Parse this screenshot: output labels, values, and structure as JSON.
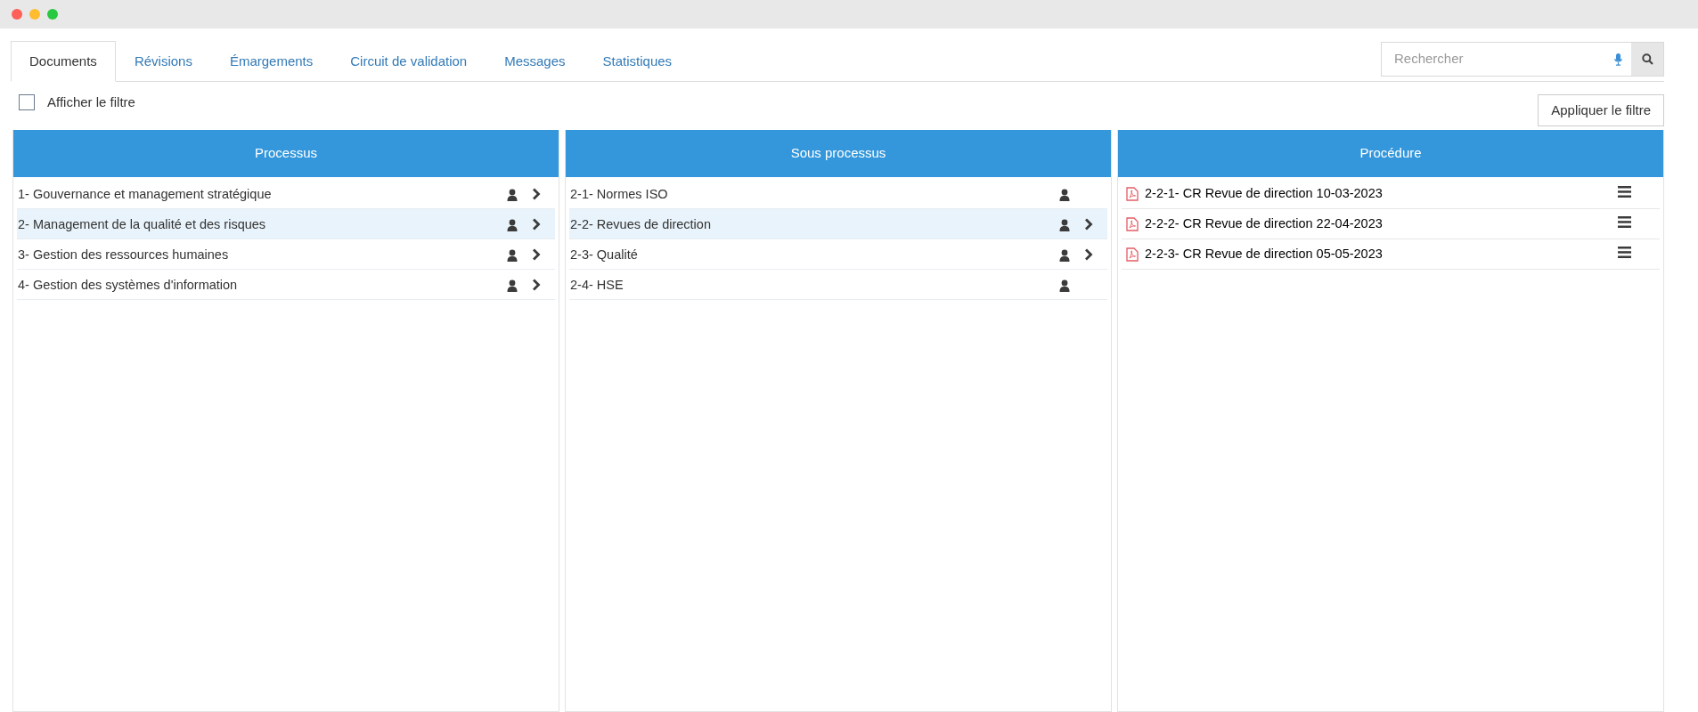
{
  "tabs": [
    {
      "label": "Documents",
      "selected": true
    },
    {
      "label": "Révisions",
      "selected": false
    },
    {
      "label": "Émargements",
      "selected": false
    },
    {
      "label": "Circuit de validation",
      "selected": false
    },
    {
      "label": "Messages",
      "selected": false
    },
    {
      "label": "Statistiques",
      "selected": false
    }
  ],
  "search": {
    "placeholder": "Rechercher"
  },
  "filter": {
    "label": "Afficher le filtre",
    "checked": false,
    "apply_button": "Appliquer le filtre"
  },
  "columns": [
    {
      "title": "Processus",
      "kind": "tree",
      "items": [
        {
          "label": "1- Gouvernance et management stratégique",
          "selected": false,
          "has_children": true
        },
        {
          "label": "2- Management de la qualité et des risques",
          "selected": true,
          "has_children": true
        },
        {
          "label": "3- Gestion des ressources humaines",
          "selected": false,
          "has_children": true
        },
        {
          "label": "4- Gestion des systèmes d'information",
          "selected": false,
          "has_children": true
        }
      ]
    },
    {
      "title": "Sous processus",
      "kind": "tree",
      "items": [
        {
          "label": "2-1- Normes ISO",
          "selected": false,
          "has_children": false
        },
        {
          "label": "2-2- Revues de direction",
          "selected": true,
          "has_children": true
        },
        {
          "label": "2-3- Qualité",
          "selected": false,
          "has_children": true
        },
        {
          "label": "2-4- HSE",
          "selected": false,
          "has_children": false
        }
      ]
    },
    {
      "title": "Procédure",
      "kind": "documents",
      "items": [
        {
          "label": "2-2-1- CR Revue de direction 10-03-2023",
          "selected": false
        },
        {
          "label": "2-2-2- CR Revue de direction 22-04-2023",
          "selected": false
        },
        {
          "label": "2-2-3- CR Revue de direction 05-05-2023",
          "selected": false
        }
      ]
    }
  ]
}
